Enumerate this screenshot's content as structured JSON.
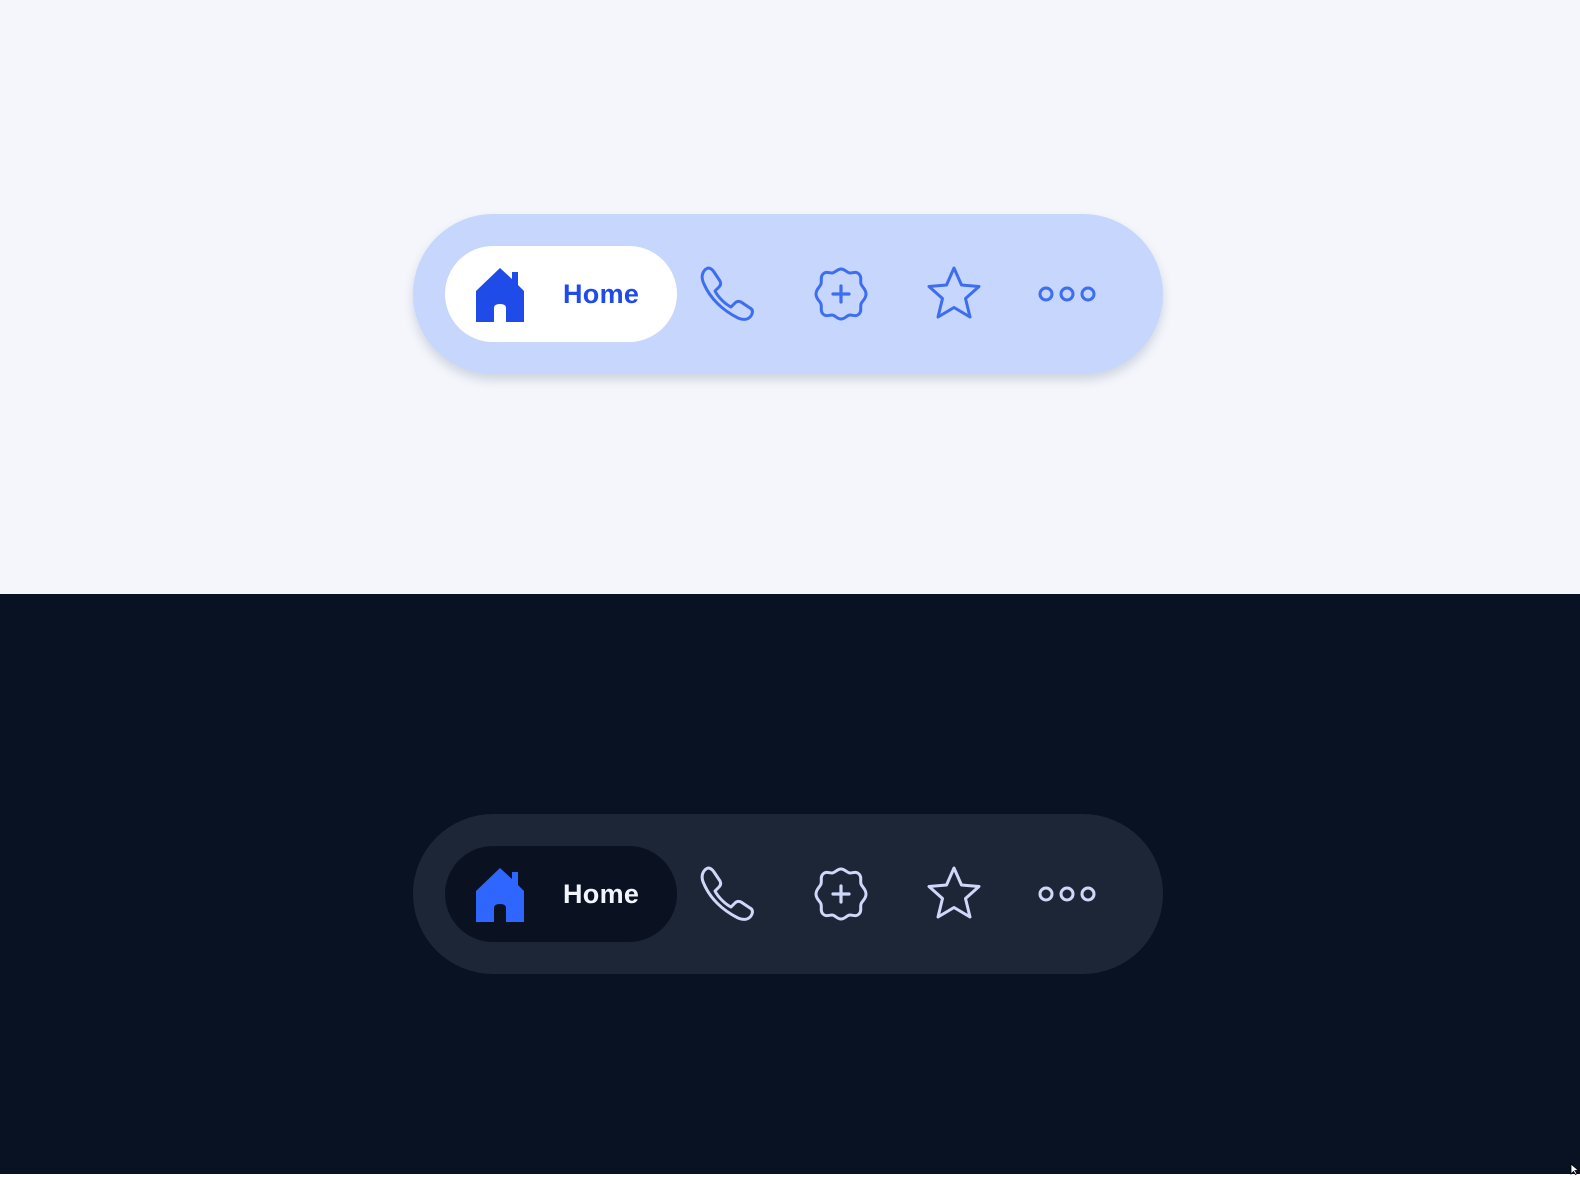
{
  "light_nav": {
    "items": [
      {
        "icon": "home-icon",
        "label": "Home",
        "active": true
      },
      {
        "icon": "phone-icon"
      },
      {
        "icon": "add-badge-icon"
      },
      {
        "icon": "star-icon"
      },
      {
        "icon": "more-icon"
      }
    ]
  },
  "dark_nav": {
    "items": [
      {
        "icon": "home-icon",
        "label": "Home",
        "active": true
      },
      {
        "icon": "phone-icon"
      },
      {
        "icon": "add-badge-icon"
      },
      {
        "icon": "star-icon"
      },
      {
        "icon": "more-icon"
      }
    ]
  },
  "colors": {
    "light_background": "#f4f6fb",
    "light_nav_background": "#c6d6fc",
    "light_active_pill": "#ffffff",
    "light_accent": "#1f4ce8",
    "light_icon": "#3d6df0",
    "dark_background": "#081223",
    "dark_nav_background": "#1d2637",
    "dark_active_pill": "#0a1222",
    "dark_accent": "#2f66ff",
    "dark_icon": "#cfd8f8"
  }
}
